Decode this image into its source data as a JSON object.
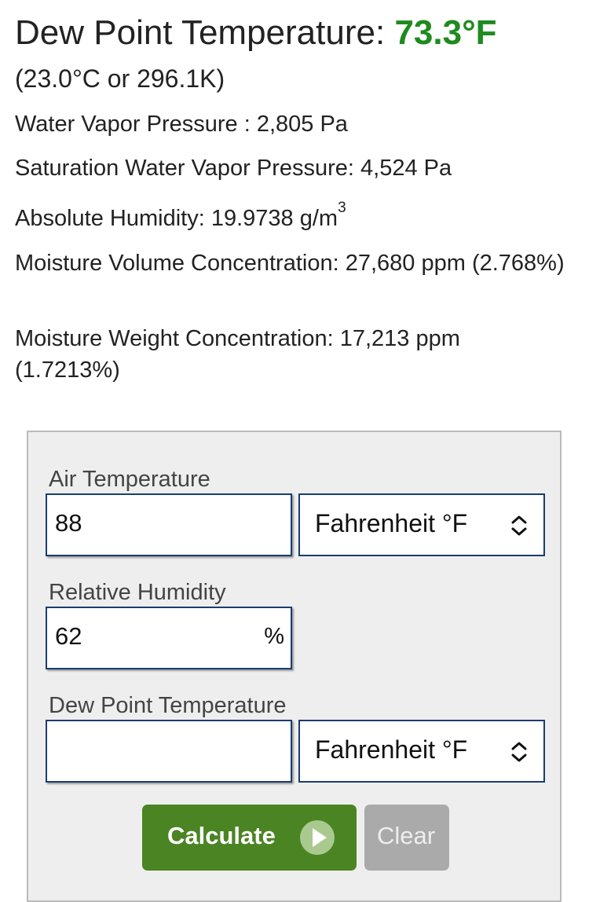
{
  "result": {
    "title_label": "Dew Point Temperature:",
    "title_value": "73.3°F",
    "conversion": "(23.0°C or 296.1K)",
    "water_vapor_pressure": "Water Vapor Pressure : 2,805 Pa",
    "saturation_water_vapor_pressure": "Saturation Water Vapor Pressure: 4,524 Pa",
    "absolute_humidity": "Absolute Humidity: 19.9738 g/m",
    "absolute_humidity_exp": "3",
    "moisture_volume_concentration": "Moisture Volume Concentration: 27,680 ppm (2.768%)",
    "moisture_weight_concentration": "Moisture Weight Concentration: 17,213 ppm (1.7213%)"
  },
  "form": {
    "air_temperature": {
      "label": "Air Temperature",
      "value": "88",
      "unit_option": "Fahrenheit °F"
    },
    "relative_humidity": {
      "label": "Relative Humidity",
      "value": "62",
      "unit": "%"
    },
    "dew_point": {
      "label": "Dew Point Temperature",
      "value": "",
      "unit_option": "Fahrenheit °F"
    },
    "calculate_label": "Calculate",
    "clear_label": "Clear"
  },
  "colors": {
    "result_value": "#1f8a1f",
    "calculate_button": "#4b8423",
    "clear_button": "#aaaaaa",
    "field_border": "#1a3d6e",
    "panel_background": "#eeeeee"
  },
  "icons": {
    "select_chevron": "chevron-up-down-icon",
    "calculate_arrow": "play-arrow-icon"
  }
}
